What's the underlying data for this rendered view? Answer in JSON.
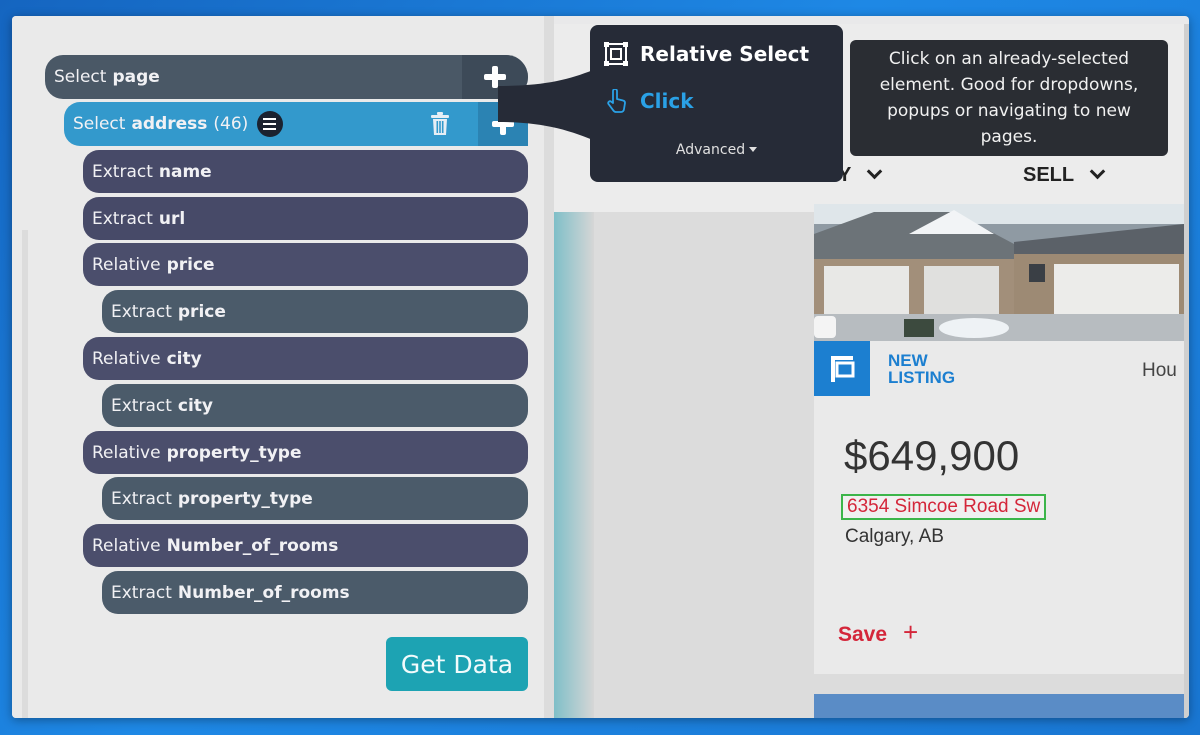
{
  "tree": {
    "rows": [
      {
        "kind": "Select",
        "name": "page"
      },
      {
        "kind": "Select",
        "name": "address",
        "count": "(46)"
      },
      {
        "kind": "Extract",
        "name": "name"
      },
      {
        "kind": "Extract",
        "name": "url"
      },
      {
        "kind": "Relative",
        "name": "price"
      },
      {
        "kind": "Extract",
        "name": "price"
      },
      {
        "kind": "Relative",
        "name": "city"
      },
      {
        "kind": "Extract",
        "name": "city"
      },
      {
        "kind": "Relative",
        "name": "property_type"
      },
      {
        "kind": "Extract",
        "name": "property_type"
      },
      {
        "kind": "Relative",
        "name": "Number_of_rooms"
      },
      {
        "kind": "Extract",
        "name": "Number_of_rooms"
      }
    ],
    "get_data_label": "Get Data"
  },
  "popup": {
    "title": "Relative Select",
    "click_label": "Click",
    "advanced_label": "Advanced"
  },
  "tooltip": {
    "text": "Click on an already-selected element. Good for dropdowns, popups or navigating to new pages."
  },
  "web": {
    "nav": {
      "left_partial": "Y",
      "sell": "SELL"
    },
    "listing": {
      "badge_line1": "NEW",
      "badge_line2": "LISTING",
      "side_partial": "Hou",
      "price": "$649,900",
      "address": "6354 Simcoe Road Sw",
      "city": "Calgary, AB",
      "save_label": "Save",
      "save_plus": "+"
    }
  },
  "colors": {
    "accent_blue": "#3399cc",
    "get_data": "#1da3b3",
    "popup_bg": "#262b37",
    "click_blue": "#2aa1e6",
    "address_red": "#d4263a",
    "highlight_green": "#3cb54a"
  }
}
